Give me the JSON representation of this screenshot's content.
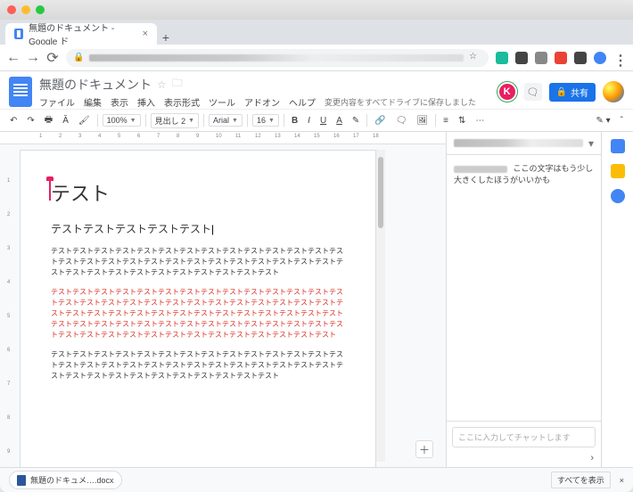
{
  "browser": {
    "tab_title": "無題のドキュメント - Google ド",
    "url_placeholder": "docs.google.com/document/d/..."
  },
  "docs": {
    "title": "無題のドキュメント",
    "menus": [
      "ファイル",
      "編集",
      "表示",
      "挿入",
      "表示形式",
      "ツール",
      "アドオン",
      "ヘルプ"
    ],
    "save_msg": "変更内容をすべてドライブに保存しました",
    "collab_initial": "K",
    "share_label": "共有"
  },
  "toolbar": {
    "zoom": "100%",
    "style": "見出し 2",
    "font": "Arial",
    "size": "16",
    "bold": "B",
    "italic": "I",
    "underline": "U"
  },
  "content": {
    "h1": "テスト",
    "h2": "テストテストテストテストテスト",
    "p1": "テストテストテストテストテストテストテストテストテストテストテストテストテストテストテストテストテストテストテストテストテストテストテストテストテストテストテストテストテストテストテストテストテストテストテストテストテストテスト",
    "p2_red": "テストテストテストテストテストテストテストテストテストテストテストテストテストテストテストテストテストテストテストテストテストテストテストテストテストテストテストテストテストテストテストテストテストテストテストテストテストテストテストテストテストテストテストテストテストテストテストテストテストテストテストテストテストテストテストテストテストテストテストテストテストテストテストテストテストテストテストテスト",
    "p3": "テストテストテストテストテストテストテストテストテストテストテストテストテストテストテストテストテストテストテストテストテストテストテストテストテストテストテストテストテストテストテストテストテストテストテストテストテストテスト"
  },
  "chat": {
    "message": "ここの文字はもう少し大きくしたほうがいいかも",
    "placeholder": "ここに入力してチャットします"
  },
  "downloads": {
    "file": "無題のドキュメ….docx",
    "show_all": "すべてを表示"
  }
}
